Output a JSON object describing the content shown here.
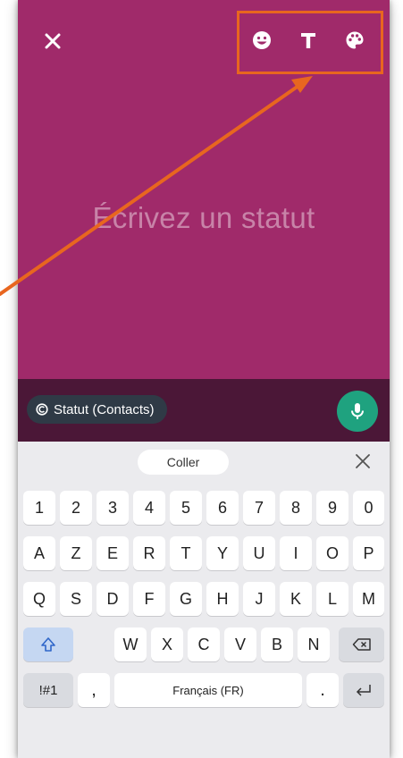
{
  "editor": {
    "placeholder": "Écrivez un statut"
  },
  "top_icons": [
    "emoji-icon",
    "text-style-icon",
    "palette-icon"
  ],
  "audience": {
    "label": "Statut (Contacts)"
  },
  "keyboard": {
    "paste_label": "Coller",
    "row1": [
      "1",
      "2",
      "3",
      "4",
      "5",
      "6",
      "7",
      "8",
      "9",
      "0"
    ],
    "row2": [
      "A",
      "Z",
      "E",
      "R",
      "T",
      "Y",
      "U",
      "I",
      "O",
      "P"
    ],
    "row3": [
      "Q",
      "S",
      "D",
      "F",
      "G",
      "H",
      "J",
      "K",
      "L",
      "M"
    ],
    "row4": [
      "W",
      "X",
      "C",
      "V",
      "B",
      "N"
    ],
    "symbols_label": "!#1",
    "comma_label": ",",
    "space_label": "Français (FR)",
    "period_label": "."
  },
  "colors": {
    "background": "#a02a6a",
    "status_bar": "#4b1737",
    "mic": "#1fa27f",
    "highlight": "#e8661f"
  }
}
